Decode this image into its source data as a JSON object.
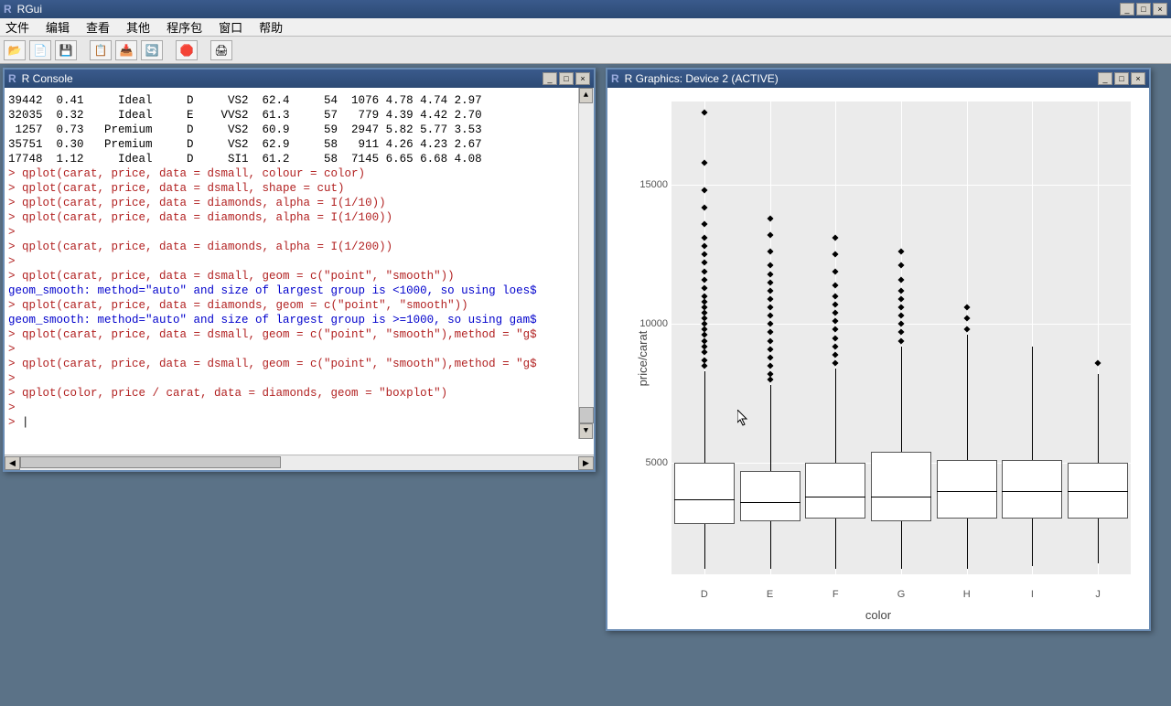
{
  "app_title": "RGui",
  "menu": [
    "文件",
    "编辑",
    "查看",
    "其他",
    "程序包",
    "窗口",
    "帮助"
  ],
  "toolbar_icons": [
    "open",
    "load",
    "save",
    "copy",
    "paste",
    "refresh",
    "stop",
    "print"
  ],
  "console": {
    "title": "R Console",
    "lines": [
      {
        "c": "black",
        "t": "39442  0.41     Ideal     D     VS2  62.4     54  1076 4.78 4.74 2.97"
      },
      {
        "c": "black",
        "t": "32035  0.32     Ideal     E    VVS2  61.3     57   779 4.39 4.42 2.70"
      },
      {
        "c": "black",
        "t": " 1257  0.73   Premium     D     VS2  60.9     59  2947 5.82 5.77 3.53"
      },
      {
        "c": "black",
        "t": "35751  0.30   Premium     D     VS2  62.9     58   911 4.26 4.23 2.67"
      },
      {
        "c": "black",
        "t": "17748  1.12     Ideal     D     SI1  61.2     58  7145 6.65 6.68 4.08"
      },
      {
        "c": "red",
        "t": "> qplot(carat, price, data = dsmall, colour = color)"
      },
      {
        "c": "red",
        "t": "> qplot(carat, price, data = dsmall, shape = cut)"
      },
      {
        "c": "red",
        "t": "> qplot(carat, price, data = diamonds, alpha = I(1/10))"
      },
      {
        "c": "red",
        "t": "> qplot(carat, price, data = diamonds, alpha = I(1/100))"
      },
      {
        "c": "red",
        "t": ">"
      },
      {
        "c": "red",
        "t": "> qplot(carat, price, data = diamonds, alpha = I(1/200))"
      },
      {
        "c": "red",
        "t": ">"
      },
      {
        "c": "red",
        "t": "> qplot(carat, price, data = dsmall, geom = c(\"point\", \"smooth\"))"
      },
      {
        "c": "blue",
        "t": "geom_smooth: method=\"auto\" and size of largest group is <1000, so using loes$"
      },
      {
        "c": "red",
        "t": "> qplot(carat, price, data = diamonds, geom = c(\"point\", \"smooth\"))"
      },
      {
        "c": "blue",
        "t": "geom_smooth: method=\"auto\" and size of largest group is >=1000, so using gam$"
      },
      {
        "c": "red",
        "t": "> qplot(carat, price, data = dsmall, geom = c(\"point\", \"smooth\"),method = \"g$"
      },
      {
        "c": "red",
        "t": ">"
      },
      {
        "c": "red",
        "t": "> qplot(carat, price, data = dsmall, geom = c(\"point\", \"smooth\"),method = \"g$"
      },
      {
        "c": "red",
        "t": ">"
      },
      {
        "c": "red",
        "t": "> qplot(color, price / carat, data = diamonds, geom = \"boxplot\")"
      },
      {
        "c": "red",
        "t": ">"
      },
      {
        "c": "red",
        "t": "> ",
        "cursor": true
      }
    ]
  },
  "graphics": {
    "title": "R Graphics: Device 2 (ACTIVE)"
  },
  "chart_data": {
    "type": "boxplot",
    "xlabel": "color",
    "ylabel": "price/carat",
    "ylim": [
      1000,
      18000
    ],
    "yticks": [
      5000,
      10000,
      15000
    ],
    "categories": [
      "D",
      "E",
      "F",
      "G",
      "H",
      "I",
      "J"
    ],
    "series": [
      {
        "name": "D",
        "q1": 2800,
        "median": 3700,
        "q3": 5000,
        "wlow": 1200,
        "whigh": 8300,
        "outliers": [
          8500,
          8700,
          9000,
          9200,
          9400,
          9600,
          9800,
          10000,
          10200,
          10400,
          10600,
          10800,
          11000,
          11300,
          11600,
          11900,
          12200,
          12500,
          12800,
          13100,
          13600,
          14200,
          14800,
          15800,
          17600
        ]
      },
      {
        "name": "E",
        "q1": 2900,
        "median": 3600,
        "q3": 4700,
        "wlow": 1200,
        "whigh": 7800,
        "outliers": [
          8000,
          8200,
          8500,
          8800,
          9100,
          9400,
          9700,
          10000,
          10300,
          10600,
          10900,
          11200,
          11500,
          11800,
          12100,
          12600,
          13200,
          13800
        ]
      },
      {
        "name": "F",
        "q1": 3000,
        "median": 3800,
        "q3": 5000,
        "wlow": 1200,
        "whigh": 8400,
        "outliers": [
          8600,
          8900,
          9200,
          9500,
          9800,
          10100,
          10400,
          10700,
          11000,
          11400,
          11900,
          12500,
          13100
        ]
      },
      {
        "name": "G",
        "q1": 2900,
        "median": 3800,
        "q3": 5400,
        "wlow": 1200,
        "whigh": 9200,
        "outliers": [
          9400,
          9700,
          10000,
          10300,
          10600,
          10900,
          11200,
          11600,
          12100,
          12600
        ]
      },
      {
        "name": "H",
        "q1": 3000,
        "median": 4000,
        "q3": 5100,
        "wlow": 1200,
        "whigh": 9600,
        "outliers": [
          9800,
          10200,
          10600
        ]
      },
      {
        "name": "I",
        "q1": 3000,
        "median": 4000,
        "q3": 5100,
        "wlow": 1300,
        "whigh": 9200,
        "outliers": []
      },
      {
        "name": "J",
        "q1": 3000,
        "median": 4000,
        "q3": 5000,
        "wlow": 1400,
        "whigh": 8200,
        "outliers": [
          8600
        ]
      }
    ]
  }
}
